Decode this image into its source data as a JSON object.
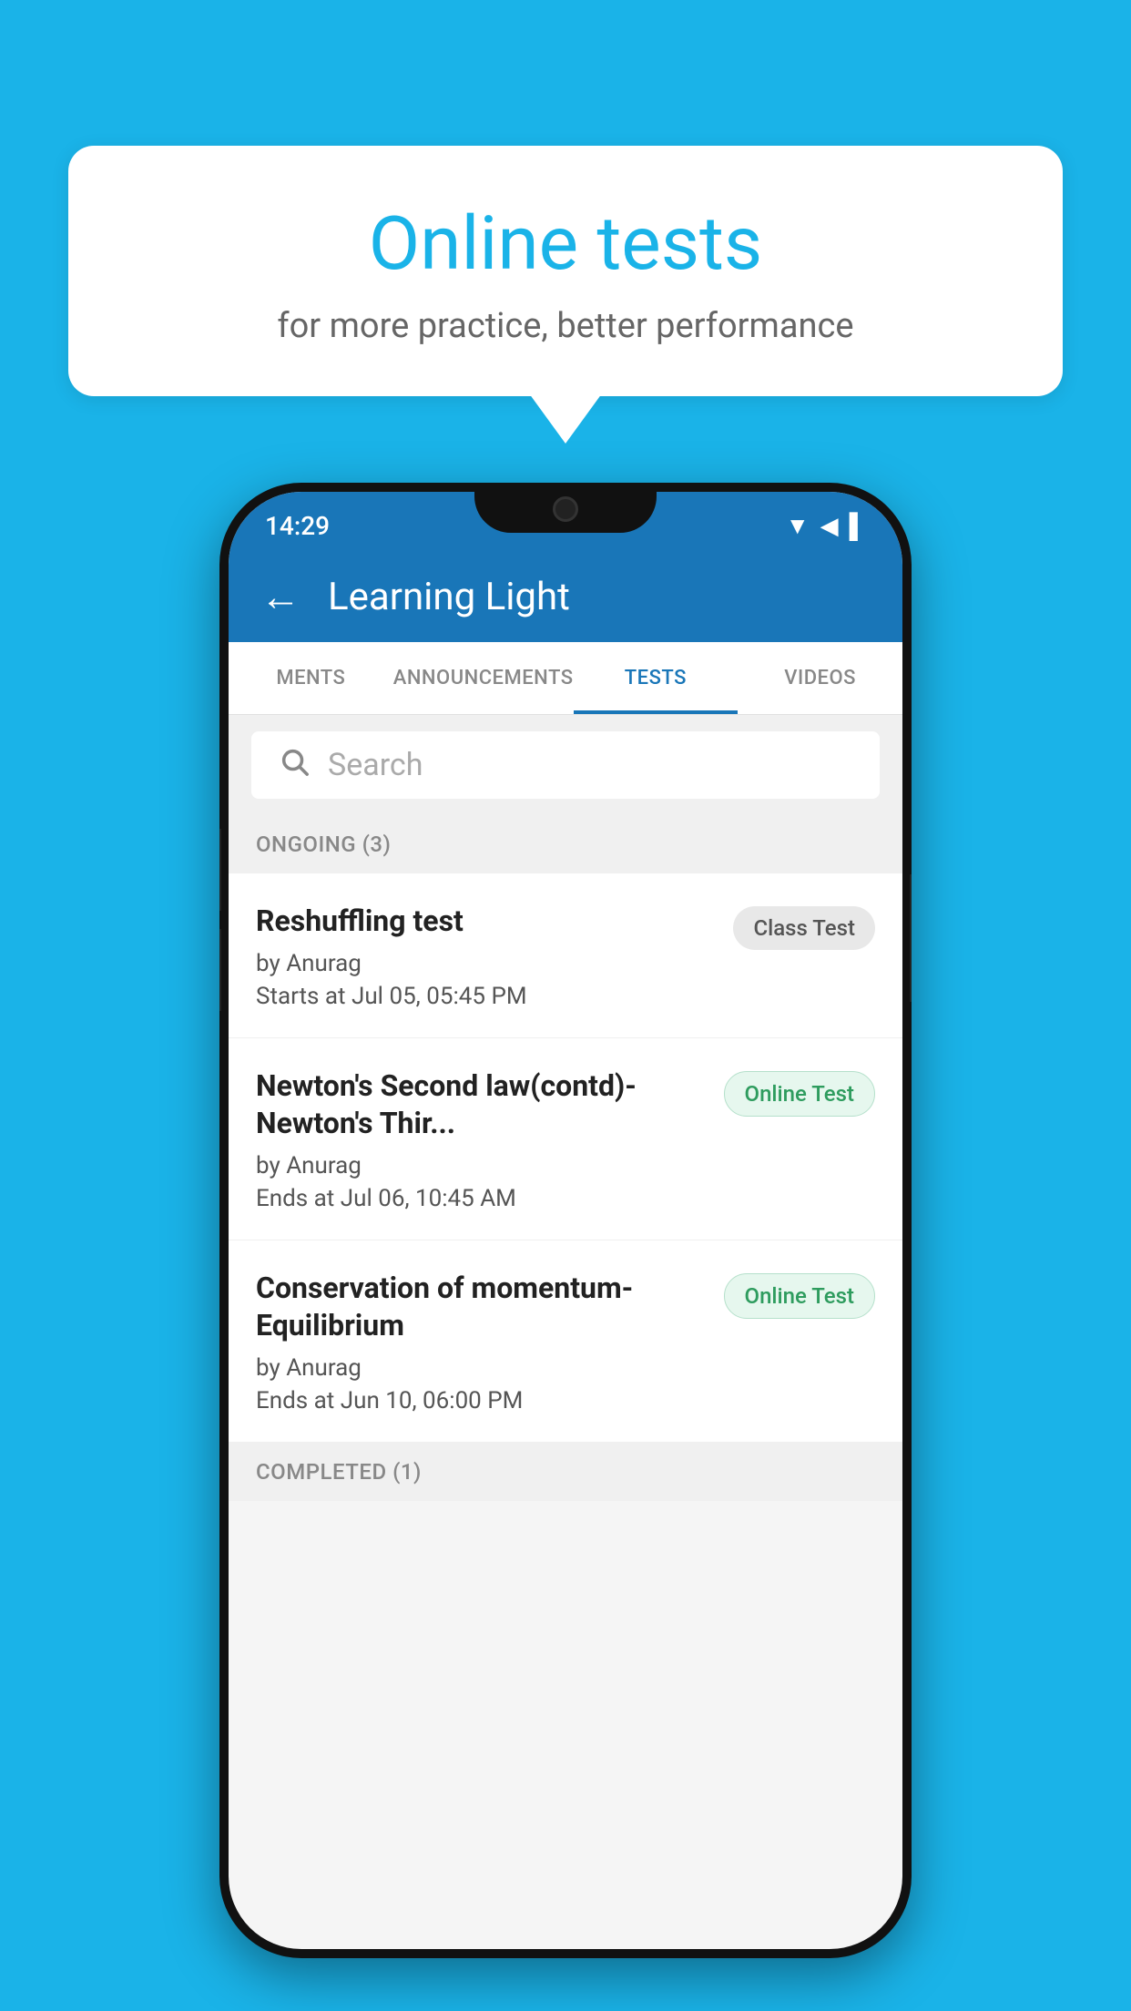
{
  "background": {
    "color": "#1ab3e8"
  },
  "bubble": {
    "title": "Online tests",
    "subtitle": "for more practice, better performance"
  },
  "phone": {
    "status_bar": {
      "time": "14:29",
      "icons": [
        "wifi",
        "signal",
        "battery"
      ]
    },
    "header": {
      "back_label": "←",
      "title": "Learning Light"
    },
    "tabs": [
      {
        "label": "MENTS",
        "active": false
      },
      {
        "label": "ANNOUNCEMENTS",
        "active": false
      },
      {
        "label": "TESTS",
        "active": true
      },
      {
        "label": "VIDEOS",
        "active": false
      }
    ],
    "search": {
      "placeholder": "Search"
    },
    "sections": [
      {
        "label": "ONGOING (3)",
        "tests": [
          {
            "name": "Reshuffling test",
            "author": "by Anurag",
            "date": "Starts at  Jul 05, 05:45 PM",
            "badge": "Class Test",
            "badge_type": "class"
          },
          {
            "name": "Newton's Second law(contd)-Newton's Thir...",
            "author": "by Anurag",
            "date": "Ends at  Jul 06, 10:45 AM",
            "badge": "Online Test",
            "badge_type": "online"
          },
          {
            "name": "Conservation of momentum-Equilibrium",
            "author": "by Anurag",
            "date": "Ends at  Jun 10, 06:00 PM",
            "badge": "Online Test",
            "badge_type": "online"
          }
        ]
      }
    ],
    "completed_label": "COMPLETED (1)"
  }
}
